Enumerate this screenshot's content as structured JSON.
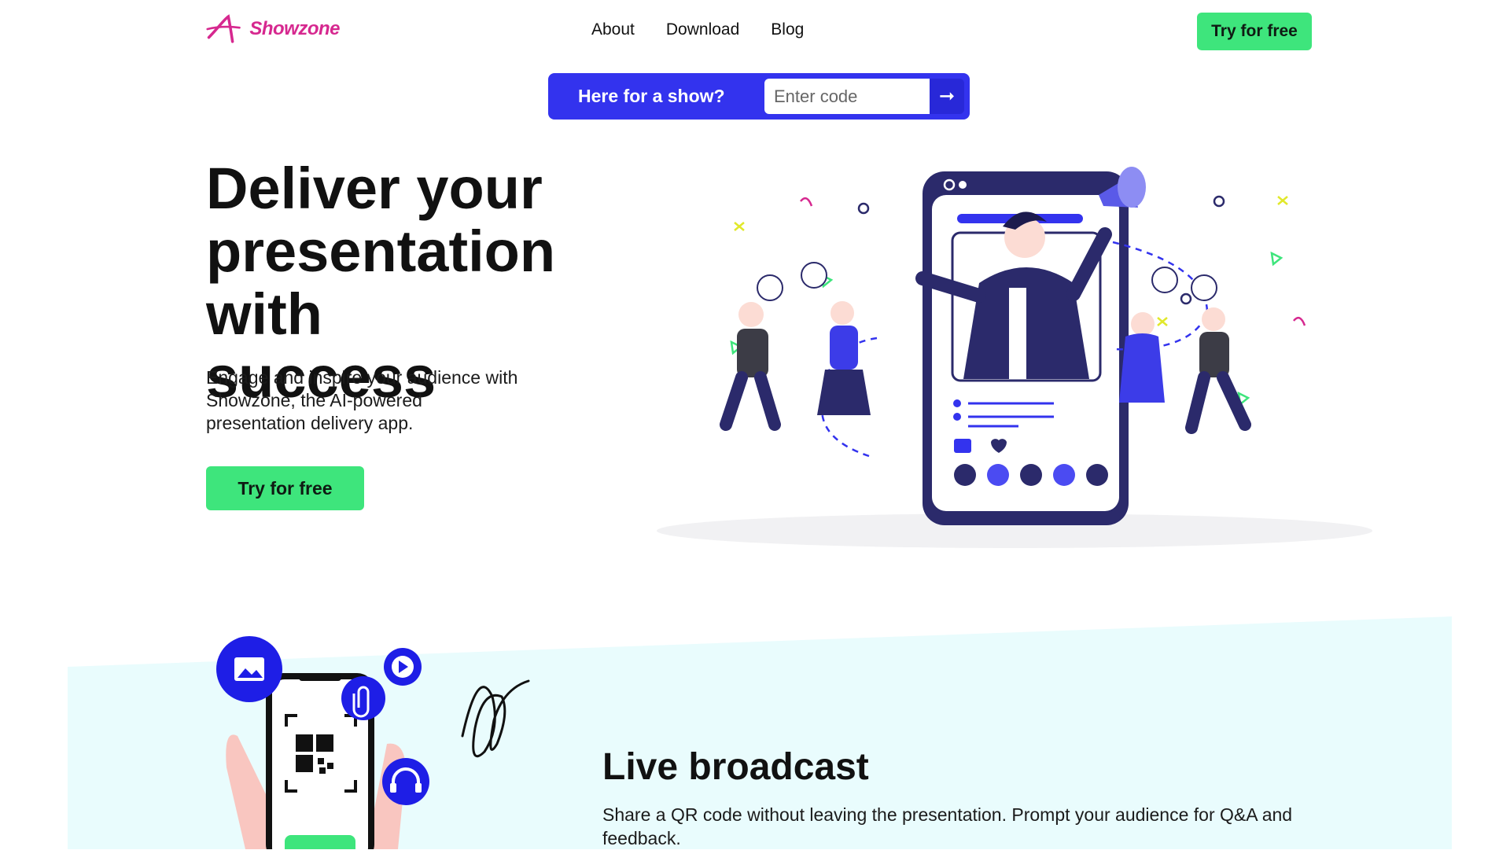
{
  "brand": {
    "name": "Showzone",
    "color": "#d6288f"
  },
  "nav": {
    "items": [
      "About",
      "Download",
      "Blog"
    ]
  },
  "header": {
    "cta_label": "Try for free"
  },
  "show_bar": {
    "label": "Here for a show?",
    "input_placeholder": "Enter code",
    "submit_icon": "arrow-right-icon"
  },
  "hero": {
    "title": "Deliver your presentation with success",
    "subtitle": "Engage and inspire your audience with Showzone, the AI-powered presentation delivery app.",
    "cta_label": "Try for free"
  },
  "feature": {
    "title": "Live broadcast",
    "description": "Share a QR code without leaving the presentation. Prompt your audience for Q&A and feedback.",
    "icons": [
      "image-icon",
      "paperclip-icon",
      "play-icon",
      "headphones-icon",
      "qr-code-icon"
    ]
  },
  "colors": {
    "accent_blue": "#3333ee",
    "accent_green": "#3ee57c",
    "band_bg": "#e9fcfd",
    "ink": "#2b2a6b"
  }
}
